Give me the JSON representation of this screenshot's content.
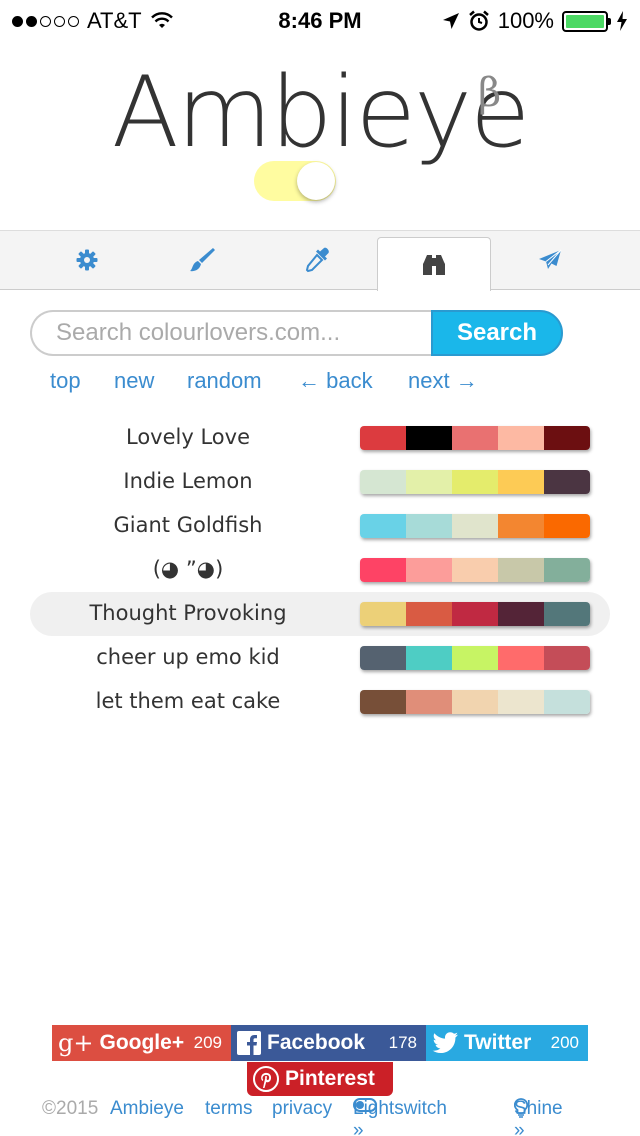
{
  "status_bar": {
    "carrier": "AT&T",
    "time": "8:46 PM",
    "battery": "100%",
    "signal_filled": 2,
    "signal_total": 5
  },
  "app": {
    "title": "Ambieye",
    "badge": "β",
    "toggle_on": true
  },
  "tabs": [
    {
      "icon": "gear-icon",
      "active": false
    },
    {
      "icon": "brush-icon",
      "active": false
    },
    {
      "icon": "eyedropper-icon",
      "active": false
    },
    {
      "icon": "binoculars-icon",
      "active": true
    },
    {
      "icon": "send-icon",
      "active": false
    }
  ],
  "search": {
    "placeholder": "Search colourlovers.com...",
    "value": "",
    "button_label": "Search"
  },
  "nav": {
    "top": "top",
    "new": "new",
    "random": "random",
    "back": "← back",
    "next": "next →"
  },
  "palettes": [
    {
      "name": "Lovely Love",
      "colors": [
        "#dc3b3f",
        "#000000",
        "#e97171",
        "#fdb9a3",
        "#6c0f11"
      ]
    },
    {
      "name": "Indie Lemon",
      "colors": [
        "#d5e6d2",
        "#e3f0a9",
        "#e4ec6c",
        "#fdcb55",
        "#4b3542"
      ]
    },
    {
      "name": "Giant Goldfish",
      "colors": [
        "#69d2e7",
        "#a7dbd8",
        "#e0e4cc",
        "#f38630",
        "#fa6900"
      ]
    },
    {
      "name": "(◕ ”◕)",
      "colors": [
        "#fe4365",
        "#fc9d9a",
        "#f9cdad",
        "#c8c8a9",
        "#83af9b"
      ]
    },
    {
      "name": "Thought Provoking",
      "colors": [
        "#ecd078",
        "#d95b43",
        "#c02942",
        "#542437",
        "#53777a"
      ]
    },
    {
      "name": "cheer up emo kid",
      "colors": [
        "#556270",
        "#4ecdc4",
        "#c7f464",
        "#ff6b6b",
        "#c44d58"
      ]
    },
    {
      "name": "let them eat cake",
      "colors": [
        "#774f38",
        "#e08e79",
        "#f1d4af",
        "#ece5ce",
        "#c5e0dc"
      ]
    }
  ],
  "social": {
    "gplus": {
      "label": "Google+",
      "count": "209"
    },
    "facebook": {
      "label": "Facebook",
      "count": "178"
    },
    "twitter": {
      "label": "Twitter",
      "count": "200"
    },
    "pinterest": {
      "label": "Pinterest"
    }
  },
  "footer": {
    "copyright": "©2015",
    "ambieye": "Ambieye",
    "terms": "terms",
    "privacy": "privacy",
    "lightswitch": "Lightswitch »",
    "shine": "Shine »"
  },
  "colors": {
    "accent": "#1ab7ea",
    "link": "#3b8ccf",
    "tab_icon": "#3b8ccf"
  }
}
